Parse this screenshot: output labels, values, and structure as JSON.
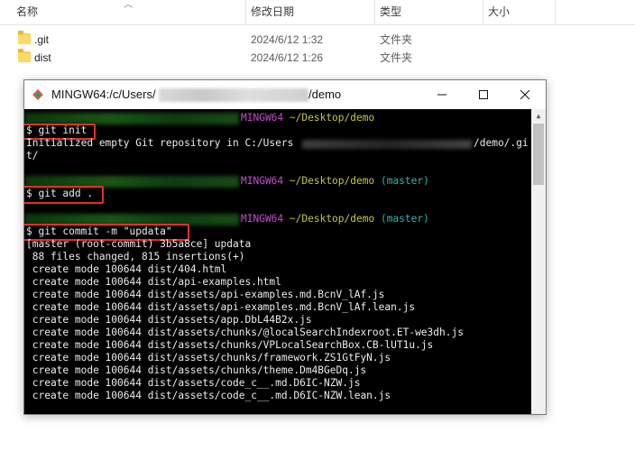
{
  "explorer": {
    "columns": [
      "名称",
      "修改日期",
      "类型",
      "大小"
    ],
    "files": [
      {
        "name": ".git",
        "date": "2024/6/12 1:32",
        "type": "文件夹",
        "size": ""
      },
      {
        "name": "dist",
        "date": "2024/6/12 1:26",
        "type": "文件夹",
        "size": ""
      }
    ]
  },
  "terminal_window": {
    "title_prefix": "MINGW64:/c/Users/",
    "title_suffix": "/demo",
    "minimize": "—",
    "maximize": "☐",
    "close": "✕"
  },
  "terminal": {
    "prompt1": {
      "host": "MINGW64",
      "path": "~/Desktop/demo",
      "branch": ""
    },
    "cmd1": "$ git init",
    "out1a_prefix": "Initialized empty Git repository in C:/Users",
    "out1a_suffix": "/demo/.gi",
    "out1b": "t/",
    "prompt2": {
      "host": "MINGW64",
      "path": "~/Desktop/demo",
      "branch": "(master)"
    },
    "cmd2": "$ git add .",
    "prompt3": {
      "host": "MINGW64",
      "path": "~/Desktop/demo",
      "branch": "(master)"
    },
    "cmd3": "$ git commit -m \"updata\"",
    "commit_output": [
      "[master (root-commit) 3b5a8ce] updata",
      " 88 files changed, 815 insertions(+)",
      " create mode 100644 dist/404.html",
      " create mode 100644 dist/api-examples.html",
      " create mode 100644 dist/assets/api-examples.md.BcnV_lAf.js",
      " create mode 100644 dist/assets/api-examples.md.BcnV_lAf.lean.js",
      " create mode 100644 dist/assets/app.DbL44B2x.js",
      " create mode 100644 dist/assets/chunks/@localSearchIndexroot.ET-we3dh.js",
      " create mode 100644 dist/assets/chunks/VPLocalSearchBox.CB-lUT1u.js",
      " create mode 100644 dist/assets/chunks/framework.ZS1GtFyN.js",
      " create mode 100644 dist/assets/chunks/theme.Dm4BGeDq.js",
      " create mode 100644 dist/assets/code_c__.md.D6IC-NZW.js",
      " create mode 100644 dist/assets/code_c__.md.D6IC-NZW.lean.js"
    ]
  }
}
